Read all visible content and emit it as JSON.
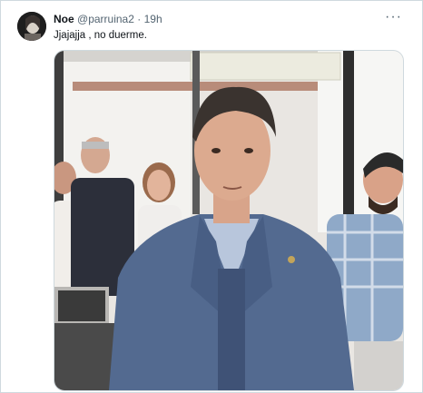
{
  "tweet": {
    "author_name": "Noe",
    "handle": "@parruina2",
    "separator": "·",
    "time": "19h",
    "text": "Jjajajja , no duerme.",
    "more_icon": "more-horizontal-icon"
  },
  "colors": {
    "text_primary": "#0f1419",
    "text_secondary": "#536471",
    "border": "#cfd9de"
  }
}
